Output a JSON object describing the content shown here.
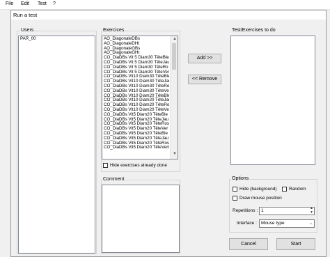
{
  "menu": [
    "File",
    "Edit",
    "Test",
    "?"
  ],
  "window": {
    "title": "Run a test"
  },
  "users": {
    "label": "Users",
    "items": [
      "PAR_00"
    ]
  },
  "exercices": {
    "label": "Exercices",
    "items": [
      "AO_DiagonaleDBs",
      "AO_DiagonaleDHt",
      "AO_DiagonaleGBs",
      "AO_DiagonaleGHt",
      "CO_DiaDBs Vit 5 Diam30 TêteBle",
      "CO_DiaDBs Vit 5 Diam30 TêteJau",
      "CO_DiaDBs Vit 5 Diam30 TêteRo",
      "CO_DiaDBs Vit 5 Diam30 TêteVer",
      "CO_DiaDBs Vit10 Diam30 TêteBle",
      "CO_DiaDBs Vit10 Diam30 TêteJau",
      "CO_DiaDBs Vit10 Diam30 TêteRo",
      "CO_DiaDBs Vit10 Diam30 TêteVer",
      "CO_DiaDBs Vit10 Diam20 TêteBle",
      "CO_DiaDBs Vit10 Diam20 TêteJau",
      "CO_DiaDBs Vit10 Diam20 TêteRo",
      "CO_DiaDBs Vit10 Diam20 TêteVer",
      "CO_DiaDBs Vit5 Diam20 TêteBle",
      "CO_DiaDBs Vit5 Diam20 TêteJau",
      "CO_DiaDBs Vit5 Diam20 TêteRos",
      "CO_DiaDBs Vit5 Diam20 TêteVer",
      "CO_DiaDBs Vit5 Diam20 TêteBle",
      "CO_DiaDBs Vit5 Diam20 TêteJau",
      "CO_DiaDBs Vit5 Diam20 TêteRos",
      "CO_DiaDBs Vit5 Diam20 TêteVert"
    ],
    "hide_label": "Hide exercises already done"
  },
  "buttons": {
    "add": "Add >>",
    "remove": "<< Remove",
    "cancel": "Cancel",
    "start": "Start"
  },
  "todo": {
    "label": "Test/Exercises to do"
  },
  "comment": {
    "label": "Comment"
  },
  "options": {
    "label": "Options",
    "hide_background": "Hide (background)",
    "random": "Random",
    "draw_mouse": "Draw mouse position",
    "repetitions_label": "Repetitions :",
    "repetitions_value": "1",
    "interface_label": "Interface :",
    "interface_value": "Mouse type"
  }
}
